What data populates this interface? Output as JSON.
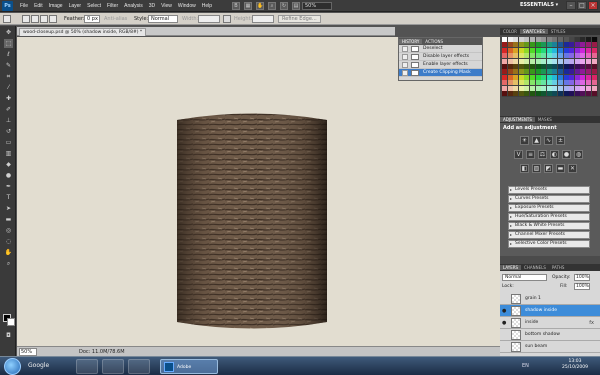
{
  "menubar": {
    "logo": "Ps",
    "items": [
      "File",
      "Edit",
      "Image",
      "Layer",
      "Select",
      "Filter",
      "Analysis",
      "3D",
      "View",
      "Window",
      "Help"
    ],
    "zoom": "50%",
    "workspace": "ESSENTIALS ▾",
    "window_buttons": [
      "–",
      "□",
      "×"
    ]
  },
  "options": {
    "feather_label": "Feather:",
    "feather_value": "0 px",
    "antialias_label": "Anti-alias",
    "style_label": "Style:",
    "style_value": "Normal",
    "width_label": "Width:",
    "height_label": "Height:",
    "refine_edge": "Refine Edge..."
  },
  "document": {
    "tab_title": "wood-closeup.psd @ 50% (shadow inside, RGB/8#) *",
    "zoom": "50%",
    "doc_info": "Doc: 11.0M/78.6M"
  },
  "history": {
    "tabs": [
      "HISTORY",
      "ACTIONS"
    ],
    "items": [
      "Deselect",
      "Disable layer effects",
      "Enable layer effects",
      "Create Clipping Mask"
    ],
    "selected_index": 3
  },
  "right_panels": {
    "swatch_tabs": [
      "COLOR",
      "SWATCHES",
      "STYLES"
    ],
    "adjust_tabs": [
      "ADJUSTMENTS",
      "MASKS"
    ],
    "adjust_title": "Add an adjustment",
    "presets": [
      "Levels Presets",
      "Curves Presets",
      "Exposure Presets",
      "Hue/Saturation Presets",
      "Black & White Presets",
      "Channel Mixer Presets",
      "Selective Color Presets"
    ],
    "layers_tabs": [
      "LAYERS",
      "CHANNELS",
      "PATHS"
    ],
    "blend_mode": "Normal",
    "opacity_label": "Opacity:",
    "opacity_value": "100%",
    "lock_label": "Lock:",
    "fill_label": "Fill:",
    "fill_value": "100%",
    "layers": [
      {
        "name": "grain 1",
        "selected": false,
        "fx": false
      },
      {
        "name": "shadow inside",
        "selected": true,
        "fx": false
      },
      {
        "name": "inside",
        "selected": false,
        "fx": true
      },
      {
        "name": "bottom shadow",
        "selected": false,
        "fx": false
      },
      {
        "name": "sun beam",
        "selected": false,
        "fx": false
      }
    ]
  },
  "taskbar": {
    "search": "Google",
    "active_app": "Adobe Photosho...",
    "time": "13:03",
    "date": "25/10/2009",
    "lang": "EN"
  },
  "colors": {
    "canvas_bg": "#e2ddd0",
    "selection_blue": "#3d8cd9"
  }
}
